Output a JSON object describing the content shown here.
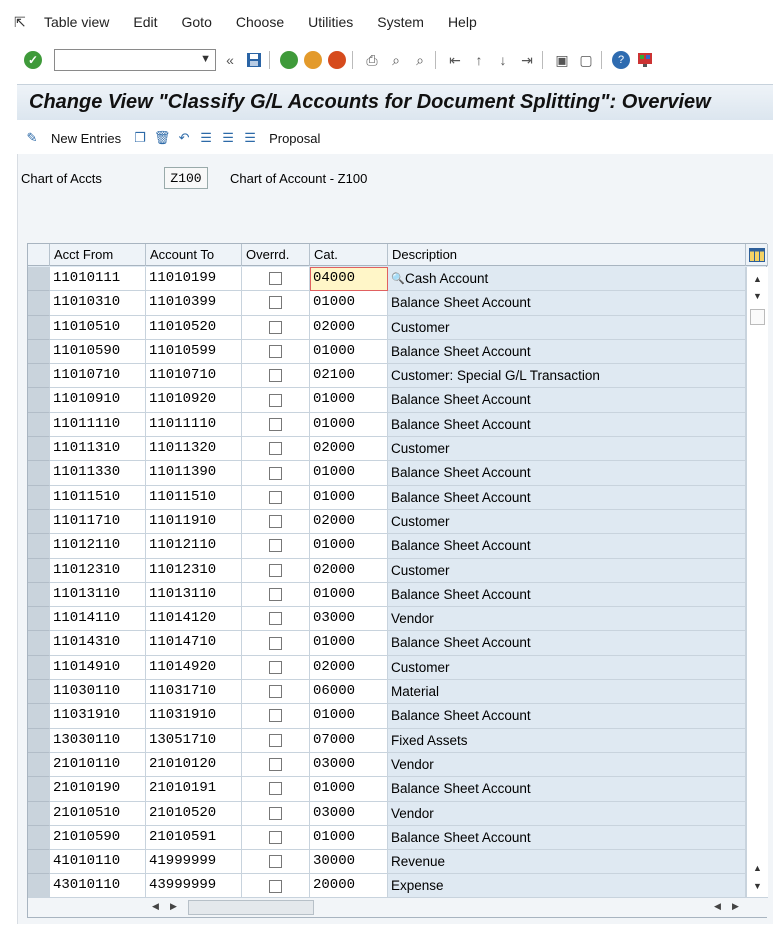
{
  "menu": {
    "items": [
      {
        "label": "Table view"
      },
      {
        "label": "Edit"
      },
      {
        "label": "Goto"
      },
      {
        "label": "Choose"
      },
      {
        "label": "Utilities"
      },
      {
        "label": "System"
      },
      {
        "label": "Help"
      }
    ]
  },
  "toolbar": {
    "command_field_value": "",
    "icons": [
      "enter-icon",
      "save-icon",
      "back-icon",
      "exit-icon",
      "cancel-icon",
      "print-icon",
      "find-icon",
      "find-next-icon",
      "first-page-icon",
      "previous-page-icon",
      "next-page-icon",
      "last-page-icon",
      "new-session-icon",
      "shortcut-icon",
      "help-icon",
      "layout-icon"
    ]
  },
  "title": "Change View \"Classify G/L Accounts for Document Splitting\": Overview",
  "app_toolbar": {
    "new_entries_label": "New Entries",
    "proposal_label": "Proposal"
  },
  "header": {
    "chart_label": "Chart of Accts",
    "chart_value": "Z100",
    "chart_desc": "Chart of Account - Z100"
  },
  "table": {
    "columns": [
      "Acct From",
      "Account To",
      "Overrd.",
      "Cat.",
      "Description"
    ],
    "rows": [
      {
        "from": "11010111",
        "to": "11010199",
        "cat": "04000",
        "desc": "Cash Account"
      },
      {
        "from": "11010310",
        "to": "11010399",
        "cat": "01000",
        "desc": "Balance Sheet Account"
      },
      {
        "from": "11010510",
        "to": "11010520",
        "cat": "02000",
        "desc": "Customer"
      },
      {
        "from": "11010590",
        "to": "11010599",
        "cat": "01000",
        "desc": "Balance Sheet Account"
      },
      {
        "from": "11010710",
        "to": "11010710",
        "cat": "02100",
        "desc": "Customer: Special G/L Transaction"
      },
      {
        "from": "11010910",
        "to": "11010920",
        "cat": "01000",
        "desc": "Balance Sheet Account"
      },
      {
        "from": "11011110",
        "to": "11011110",
        "cat": "01000",
        "desc": "Balance Sheet Account"
      },
      {
        "from": "11011310",
        "to": "11011320",
        "cat": "02000",
        "desc": "Customer"
      },
      {
        "from": "11011330",
        "to": "11011390",
        "cat": "01000",
        "desc": "Balance Sheet Account"
      },
      {
        "from": "11011510",
        "to": "11011510",
        "cat": "01000",
        "desc": "Balance Sheet Account"
      },
      {
        "from": "11011710",
        "to": "11011910",
        "cat": "02000",
        "desc": "Customer"
      },
      {
        "from": "11012110",
        "to": "11012110",
        "cat": "01000",
        "desc": "Balance Sheet Account"
      },
      {
        "from": "11012310",
        "to": "11012310",
        "cat": "02000",
        "desc": "Customer"
      },
      {
        "from": "11013110",
        "to": "11013110",
        "cat": "01000",
        "desc": "Balance Sheet Account"
      },
      {
        "from": "11014110",
        "to": "11014120",
        "cat": "03000",
        "desc": "Vendor"
      },
      {
        "from": "11014310",
        "to": "11014710",
        "cat": "01000",
        "desc": "Balance Sheet Account"
      },
      {
        "from": "11014910",
        "to": "11014920",
        "cat": "02000",
        "desc": "Customer"
      },
      {
        "from": "11030110",
        "to": "11031710",
        "cat": "06000",
        "desc": "Material"
      },
      {
        "from": "11031910",
        "to": "11031910",
        "cat": "01000",
        "desc": "Balance Sheet Account"
      },
      {
        "from": "13030110",
        "to": "13051710",
        "cat": "07000",
        "desc": "Fixed Assets"
      },
      {
        "from": "21010110",
        "to": "21010120",
        "cat": "03000",
        "desc": "Vendor"
      },
      {
        "from": "21010190",
        "to": "21010191",
        "cat": "01000",
        "desc": "Balance Sheet Account"
      },
      {
        "from": "21010510",
        "to": "21010520",
        "cat": "03000",
        "desc": "Vendor"
      },
      {
        "from": "21010590",
        "to": "21010591",
        "cat": "01000",
        "desc": "Balance Sheet Account"
      },
      {
        "from": "41010110",
        "to": "41999999",
        "cat": "30000",
        "desc": "Revenue"
      },
      {
        "from": "43010110",
        "to": "43999999",
        "cat": "20000",
        "desc": "Expense"
      }
    ]
  }
}
